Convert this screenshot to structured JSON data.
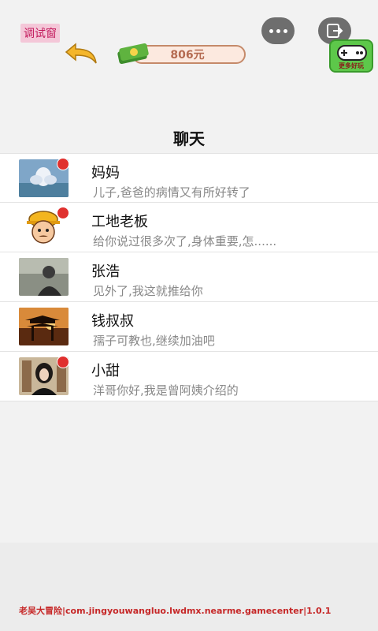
{
  "debug": {
    "label": "调试窗"
  },
  "topbar": {
    "menu_icon": "more-dots-icon",
    "exit_icon": "exit-icon",
    "back_icon": "back-arrow-icon",
    "money": {
      "icon": "cash-stack-icon",
      "amount": "806元"
    },
    "game_icon": {
      "icon": "gamepad-icon",
      "label": "更多好玩"
    }
  },
  "page": {
    "title": "聊天"
  },
  "chats": [
    {
      "name": "妈妈",
      "preview": "儿子,爸爸的病情又有所好转了",
      "unread": true
    },
    {
      "name": "工地老板",
      "preview": "给你说过很多次了,身体重要,怎......",
      "unread": true
    },
    {
      "name": "张浩",
      "preview": "见外了,我这就推给你",
      "unread": false
    },
    {
      "name": "钱叔叔",
      "preview": "孺子可教也,继续加油吧",
      "unread": false
    },
    {
      "name": "小甜",
      "preview": "洋哥你好,我是曾阿姨介绍的",
      "unread": true
    }
  ],
  "footer": {
    "text": "老吴大冒险|com.jingyouwangluo.lwdmx.nearme.gamecenter|1.0.1"
  },
  "colors": {
    "badge": "#e0302e",
    "footer_text": "#c62828",
    "money_text": "#b46a50"
  }
}
